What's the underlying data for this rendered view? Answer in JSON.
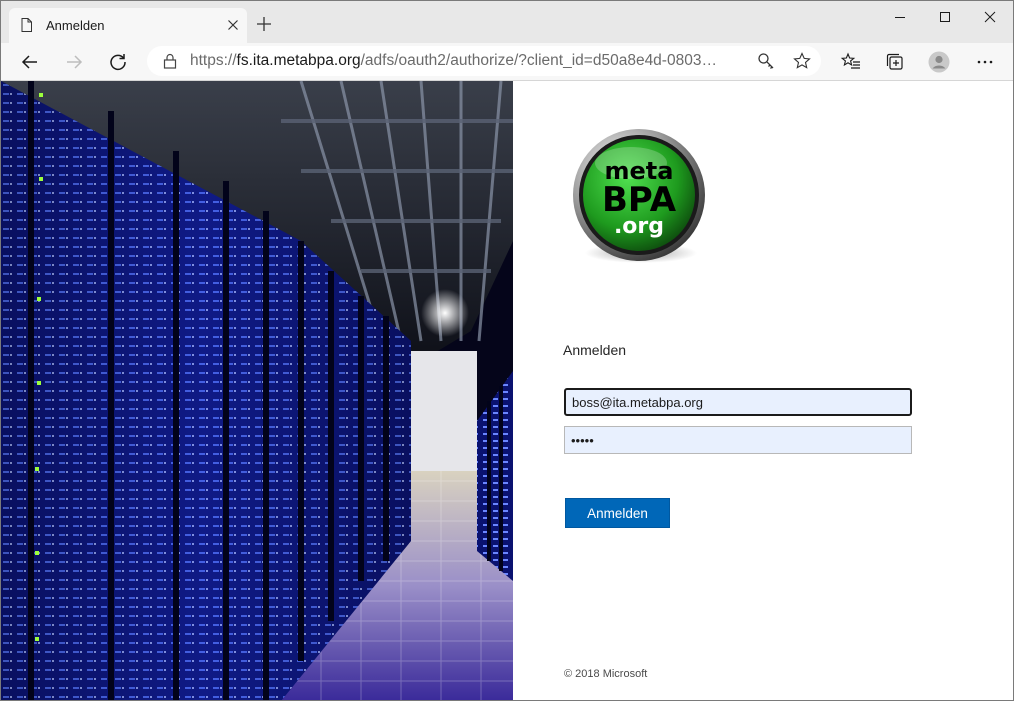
{
  "browser": {
    "tab": {
      "title": "Anmelden",
      "icon": "page-icon"
    },
    "address_bar": {
      "scheme": "https://",
      "host": "fs.ita.metabpa.org",
      "path": "/adfs/oauth2/authorize/?client_id=d50a8e4d-0803…"
    },
    "toolbar_icons": [
      "back-arrow-icon",
      "forward-arrow-icon",
      "refresh-icon",
      "lock-icon",
      "key-icon",
      "star-icon",
      "favorites-icon",
      "collections-icon",
      "profile-icon",
      "more-icon"
    ]
  },
  "page": {
    "logo": {
      "line1": "meta",
      "line2": "BPA",
      "line3": ".org"
    },
    "title": "Anmelden",
    "username": {
      "value": "boss@ita.metabpa.org"
    },
    "password": {
      "value": "•••••"
    },
    "submit_label": "Anmelden",
    "footer": "© 2018 Microsoft"
  },
  "colors": {
    "accent": "#0067b8",
    "field_bg": "#e8f0fe",
    "logo_green": "#2fa52f"
  }
}
